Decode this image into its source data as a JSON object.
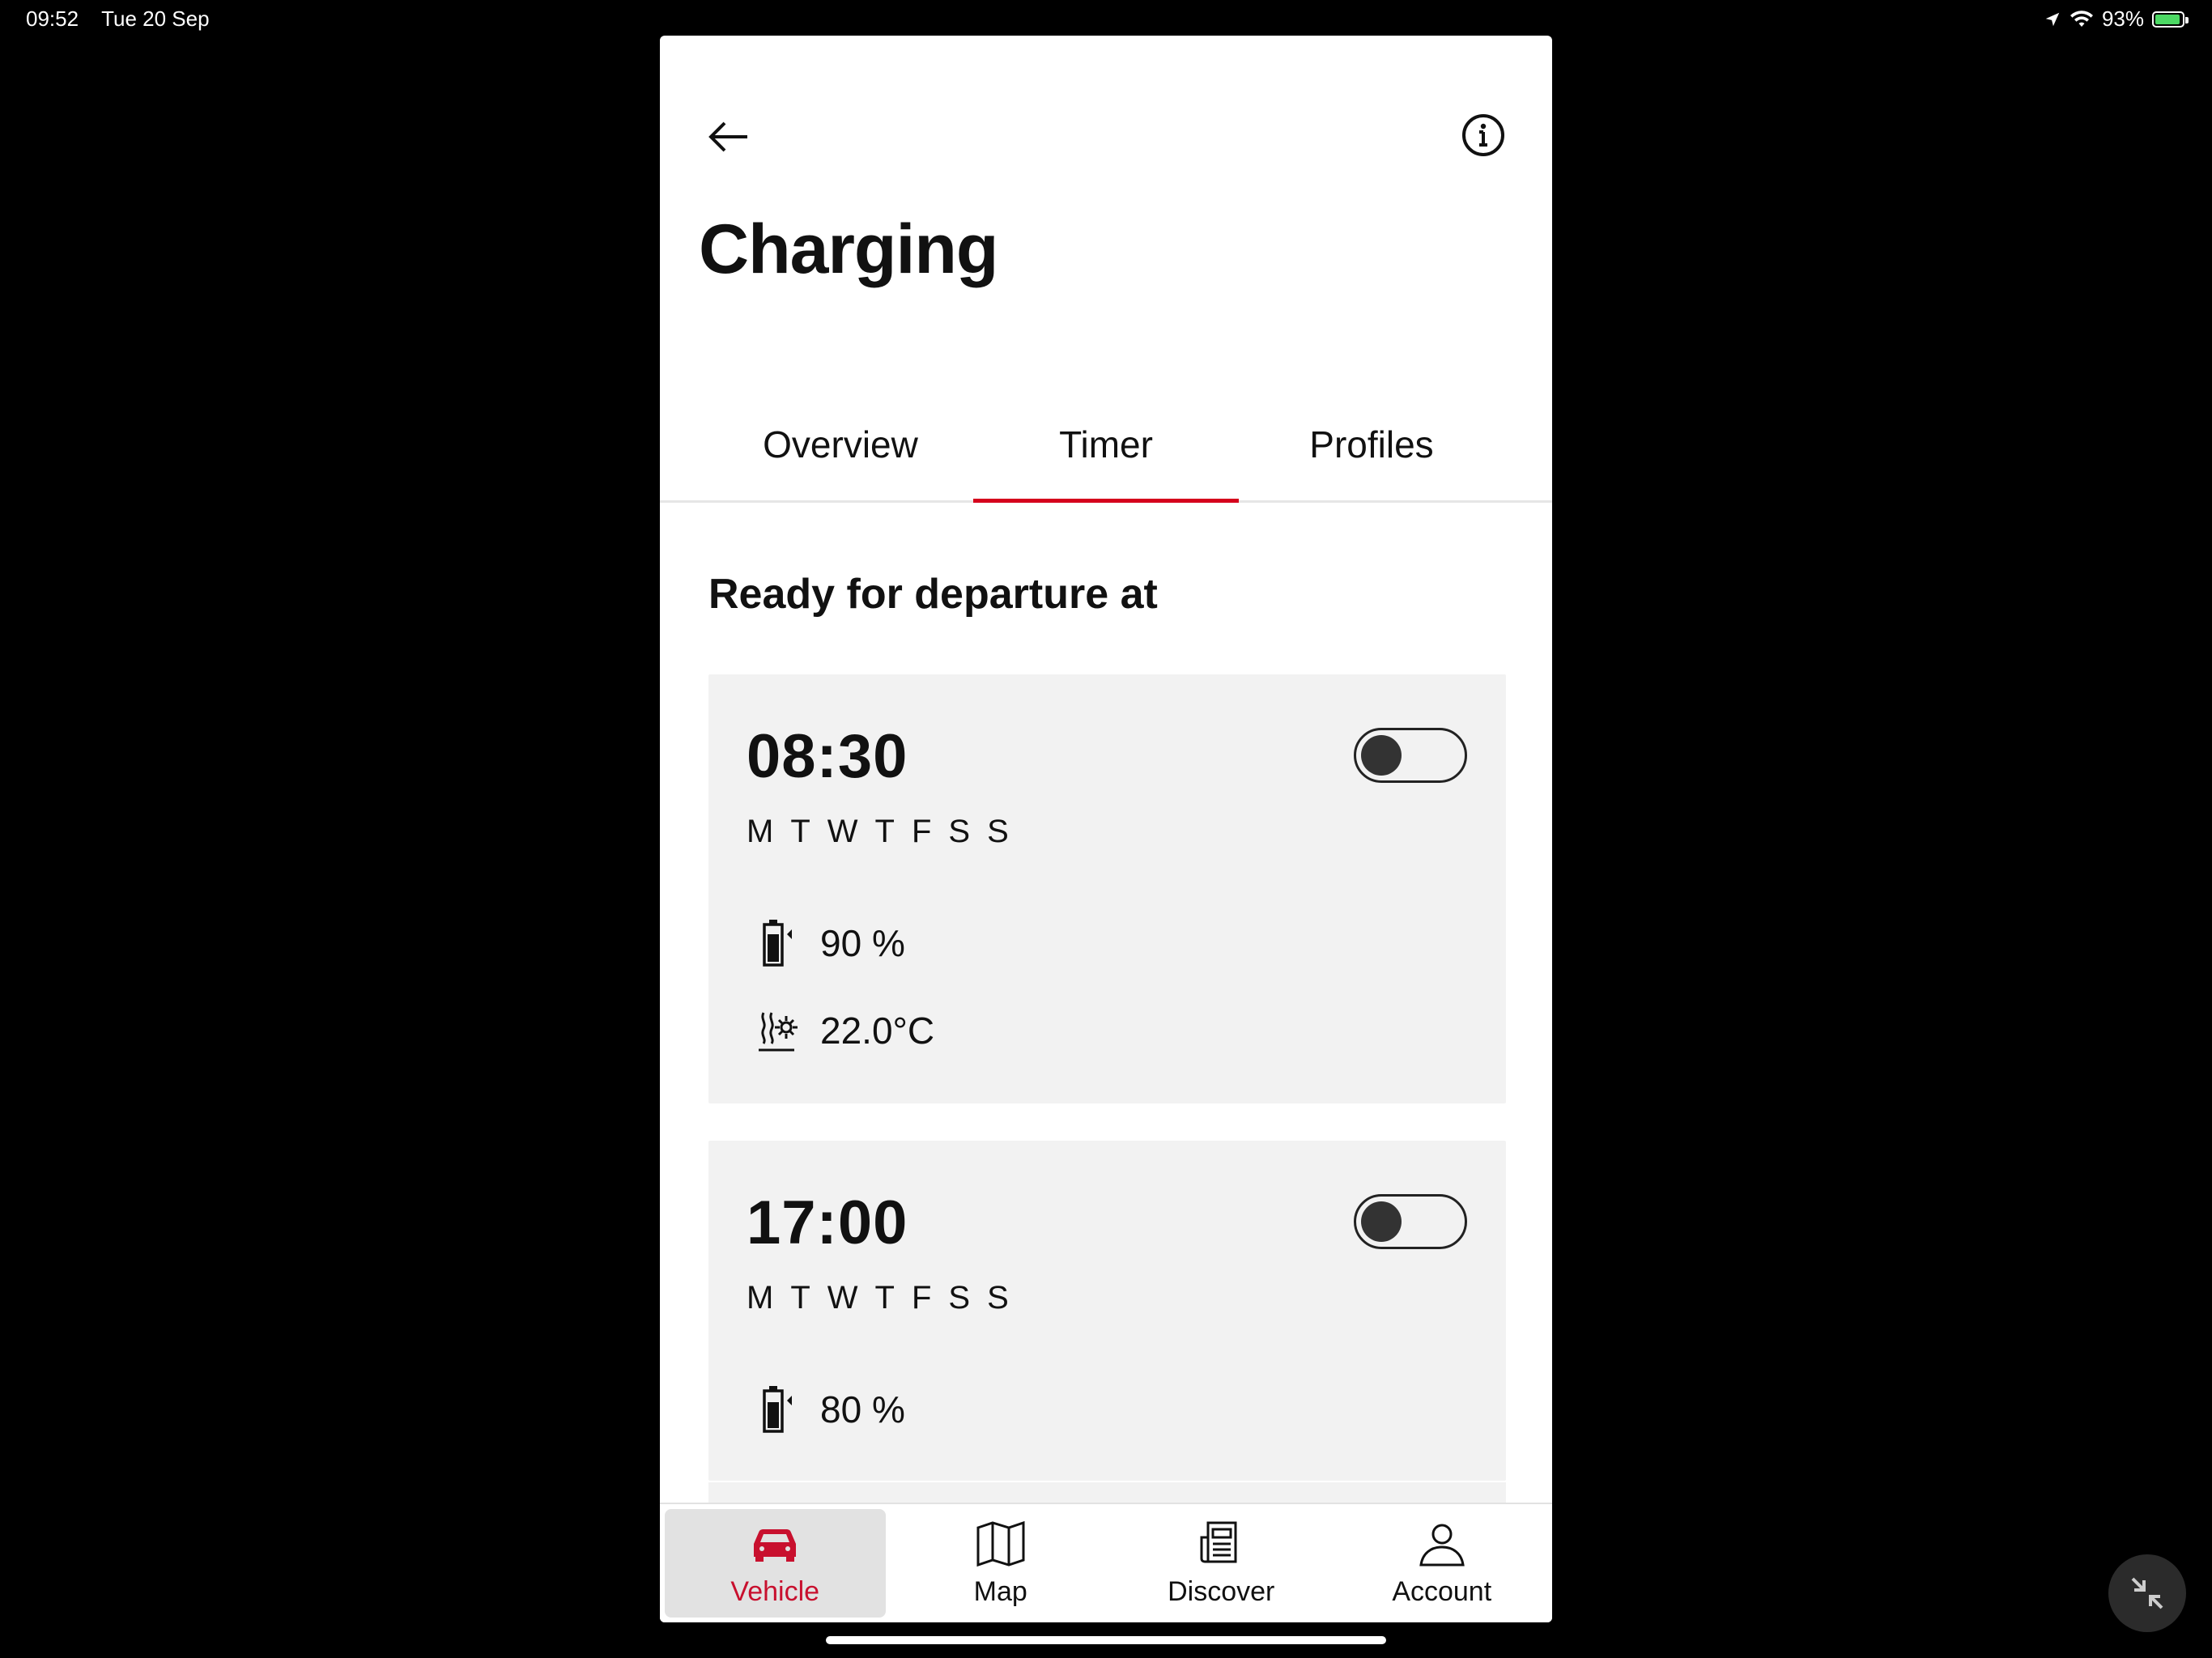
{
  "status_bar": {
    "time": "09:52",
    "date": "Tue 20 Sep",
    "battery": "93%",
    "battery_level": 0.93
  },
  "header": {
    "title": "Charging"
  },
  "tabs": [
    {
      "label": "Overview"
    },
    {
      "label": "Timer"
    },
    {
      "label": "Profiles"
    }
  ],
  "active_tab": "Timer",
  "section": {
    "title": "Ready for departure at"
  },
  "timers": [
    {
      "time": "08:30",
      "days": [
        "M",
        "T",
        "W",
        "T",
        "F",
        "S",
        "S"
      ],
      "enabled": false,
      "charge": "90 %",
      "temperature": "22.0°C"
    },
    {
      "time": "17:00",
      "days": [
        "M",
        "T",
        "W",
        "T",
        "F",
        "S",
        "S"
      ],
      "enabled": false,
      "charge": "80 %"
    }
  ],
  "bottom_nav": [
    {
      "label": "Vehicle",
      "icon": "car-icon"
    },
    {
      "label": "Map",
      "icon": "map-icon"
    },
    {
      "label": "Discover",
      "icon": "newspaper-icon"
    },
    {
      "label": "Account",
      "icon": "user-icon"
    }
  ],
  "colors": {
    "accent": "#d5001c",
    "card_bg": "#f2f2f2",
    "nav_active_bg": "#e2e2e2"
  }
}
